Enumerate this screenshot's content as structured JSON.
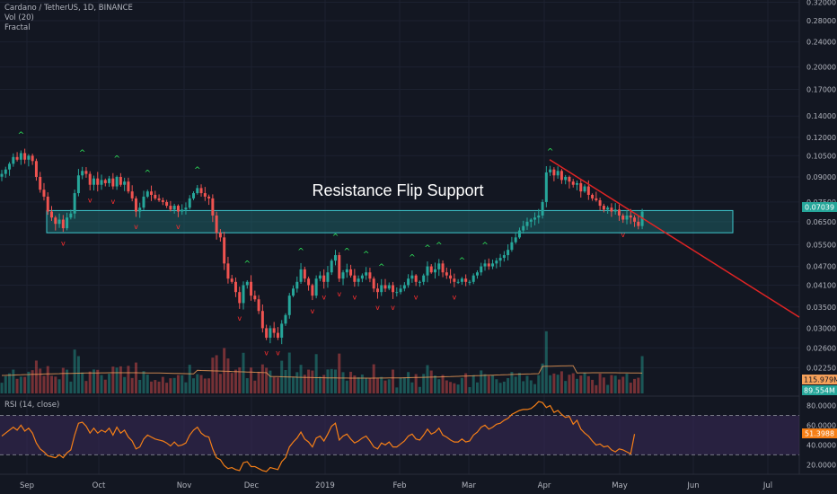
{
  "header": {
    "symbol_line": "Cardano / TetherUS, 1D, BINANCE",
    "vol_label": "Vol (20)",
    "fractal_label": "Fractal",
    "rsi_label": "RSI (14, close)"
  },
  "colors": {
    "background": "#131722",
    "up_candle": "#26a69a",
    "down_candle": "#ef5350",
    "zone_fill": "#1e6e73",
    "zone_border": "#3ec9cf",
    "trendline": "#e02424",
    "rsi_line": "#f57f17",
    "rsi_band": "#3a2a5a",
    "fractal_up": "#2ee65a",
    "fractal_down": "#ff2e2e"
  },
  "chart_data": {
    "type": "candlestick",
    "title": "Cardano / TetherUS, 1D, BINANCE",
    "annotation": "Resistance Flip Support",
    "price_axis": {
      "scale": "log",
      "ticks": [
        "0.32000",
        "0.28000",
        "0.24000",
        "0.20000",
        "0.17000",
        "0.14000",
        "0.12000",
        "0.10500",
        "0.09000",
        "0.07500",
        "0.06500",
        "0.05500",
        "0.04700",
        "0.04100",
        "0.03500",
        "0.03000",
        "0.02600",
        "0.02250"
      ]
    },
    "time_axis": {
      "labels": [
        "Sep",
        "Oct",
        "Nov",
        "Dec",
        "2019",
        "Feb",
        "Mar",
        "Apr",
        "May",
        "Jun",
        "Jul"
      ]
    },
    "support_zone": {
      "low": 0.06,
      "high": 0.0705
    },
    "trendline": {
      "from_date": "Apr 2",
      "from_price": 0.102,
      "to_date": "Jul 16",
      "to_price": 0.0325
    },
    "close_series": [
      0.092,
      0.095,
      0.099,
      0.104,
      0.102,
      0.107,
      0.102,
      0.105,
      0.101,
      0.09,
      0.082,
      0.078,
      0.07,
      0.067,
      0.064,
      0.066,
      0.062,
      0.067,
      0.069,
      0.08,
      0.091,
      0.094,
      0.092,
      0.085,
      0.089,
      0.085,
      0.088,
      0.086,
      0.089,
      0.084,
      0.09,
      0.085,
      0.087,
      0.081,
      0.077,
      0.07,
      0.072,
      0.078,
      0.081,
      0.079,
      0.077,
      0.076,
      0.075,
      0.073,
      0.071,
      0.073,
      0.07,
      0.071,
      0.072,
      0.077,
      0.08,
      0.083,
      0.08,
      0.078,
      0.077,
      0.068,
      0.06,
      0.058,
      0.048,
      0.043,
      0.042,
      0.039,
      0.036,
      0.041,
      0.042,
      0.038,
      0.037,
      0.034,
      0.03,
      0.028,
      0.03,
      0.029,
      0.028,
      0.031,
      0.033,
      0.038,
      0.04,
      0.042,
      0.046,
      0.043,
      0.041,
      0.038,
      0.043,
      0.044,
      0.042,
      0.045,
      0.049,
      0.051,
      0.043,
      0.045,
      0.046,
      0.044,
      0.042,
      0.043,
      0.044,
      0.045,
      0.043,
      0.04,
      0.039,
      0.041,
      0.04,
      0.041,
      0.039,
      0.039,
      0.04,
      0.041,
      0.043,
      0.044,
      0.042,
      0.042,
      0.044,
      0.047,
      0.045,
      0.046,
      0.048,
      0.045,
      0.044,
      0.043,
      0.042,
      0.042,
      0.043,
      0.042,
      0.042,
      0.044,
      0.045,
      0.047,
      0.048,
      0.047,
      0.048,
      0.049,
      0.05,
      0.051,
      0.053,
      0.056,
      0.058,
      0.061,
      0.063,
      0.065,
      0.066,
      0.067,
      0.068,
      0.075,
      0.093,
      0.095,
      0.091,
      0.094,
      0.088,
      0.09,
      0.087,
      0.085,
      0.086,
      0.081,
      0.084,
      0.079,
      0.077,
      0.076,
      0.073,
      0.071,
      0.072,
      0.07,
      0.071,
      0.068,
      0.066,
      0.068,
      0.067,
      0.065,
      0.063,
      0.07
    ],
    "volume": {
      "label": "Vol (20)",
      "ma_value_label": "115.979M",
      "last_value_label": "89.554M"
    },
    "rsi": {
      "label": "RSI (14, close)",
      "ticks": [
        "80.0000",
        "60.0000",
        "40.0000",
        "20.0000"
      ],
      "upper_band": 70,
      "lower_band": 30,
      "last_value_label": "51.3988",
      "values": [
        49,
        52,
        55,
        58,
        55,
        60,
        54,
        57,
        52,
        42,
        36,
        33,
        29,
        28,
        27,
        30,
        27,
        32,
        35,
        50,
        62,
        63,
        59,
        52,
        57,
        52,
        55,
        53,
        57,
        50,
        58,
        52,
        55,
        48,
        44,
        36,
        38,
        46,
        50,
        48,
        46,
        45,
        44,
        42,
        39,
        43,
        39,
        40,
        42,
        50,
        55,
        58,
        52,
        49,
        48,
        36,
        27,
        25,
        19,
        16,
        17,
        15,
        14,
        22,
        23,
        18,
        18,
        16,
        14,
        13,
        17,
        16,
        15,
        23,
        27,
        38,
        43,
        47,
        53,
        46,
        43,
        38,
        47,
        49,
        44,
        51,
        59,
        62,
        45,
        49,
        51,
        46,
        42,
        44,
        47,
        49,
        44,
        38,
        36,
        42,
        40,
        43,
        38,
        38,
        41,
        44,
        49,
        51,
        46,
        45,
        50,
        56,
        51,
        53,
        57,
        50,
        48,
        45,
        43,
        43,
        46,
        43,
        44,
        50,
        53,
        58,
        60,
        56,
        58,
        61,
        62,
        65,
        67,
        71,
        73,
        75,
        76,
        76,
        77,
        80,
        84,
        83,
        78,
        80,
        73,
        75,
        71,
        68,
        69,
        61,
        65,
        56,
        52,
        49,
        44,
        40,
        41,
        38,
        39,
        35,
        33,
        36,
        35,
        33,
        31,
        51
      ]
    }
  },
  "price_badges": {
    "current_price": "0.07039"
  }
}
